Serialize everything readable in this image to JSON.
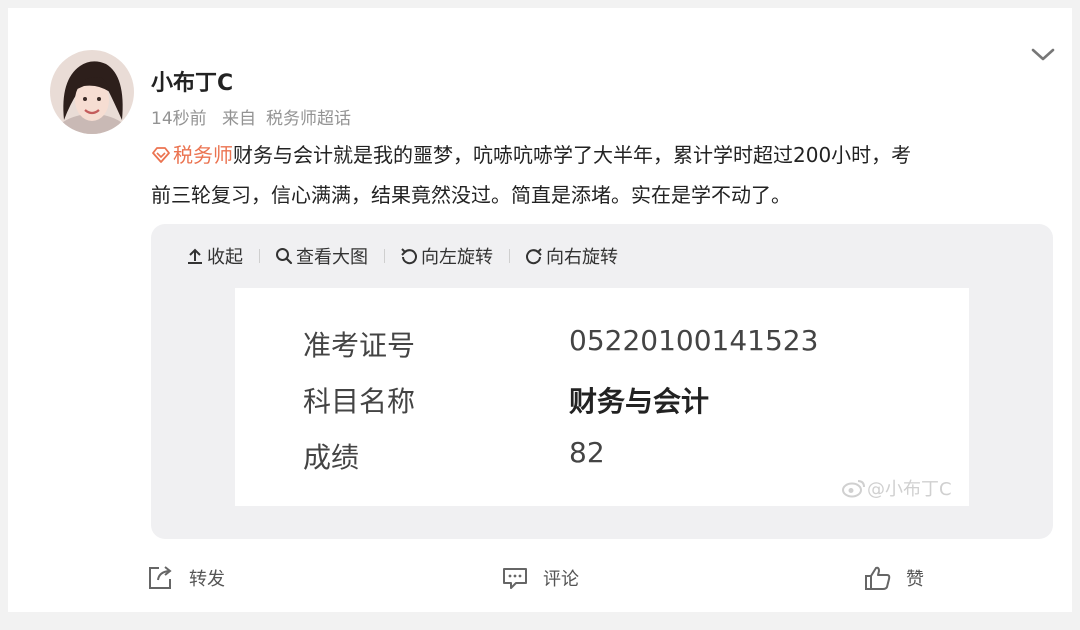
{
  "post": {
    "username": "小布丁C",
    "time": "14秒前",
    "source_prefix": "来自",
    "source": "税务师超话",
    "tag": "税务师",
    "text_line1": "财务与会计就是我的噩梦，吭哧吭哧学了大半年，累计学时超过200小时，考",
    "text_line2": "前三轮复习，信心满满，结果竟然没过。简直是添堵。实在是学不动了。",
    "tag_color": "#eb7350"
  },
  "media_toolbar": {
    "collapse": "收起",
    "view_large": "查看大图",
    "rotate_left": "向左旋转",
    "rotate_right": "向右旋转"
  },
  "photo": {
    "rows": [
      {
        "label": "准考证号",
        "value": "05220100141523"
      },
      {
        "label": "科目名称",
        "value": "财务与会计"
      },
      {
        "label": "成绩",
        "value": "82"
      }
    ],
    "watermark": "@小布丁C"
  },
  "actions": {
    "repost": "转发",
    "comment": "评论",
    "like": "赞"
  }
}
